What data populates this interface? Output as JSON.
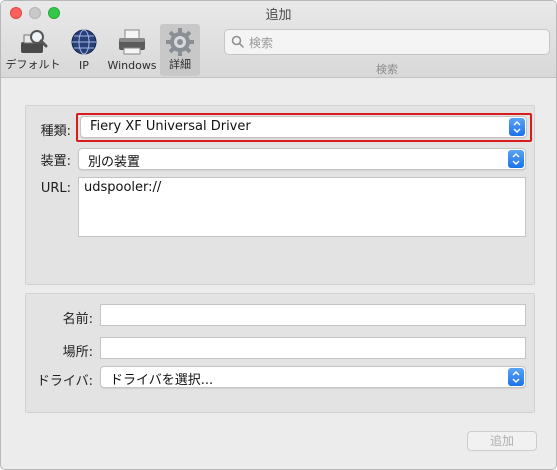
{
  "window": {
    "title": "追加"
  },
  "toolbar": {
    "items": [
      {
        "label": "デフォルト",
        "icon": "default-printers-icon"
      },
      {
        "label": "IP",
        "icon": "ip-globe-icon"
      },
      {
        "label": "Windows",
        "icon": "windows-printer-icon"
      },
      {
        "label": "詳細",
        "icon": "advanced-gear-icon",
        "selected": true
      }
    ],
    "search": {
      "placeholder": "検索",
      "caption": "検索"
    }
  },
  "form_top": {
    "type_label": "種類:",
    "type_value": "Fiery XF Universal Driver",
    "device_label": "装置:",
    "device_value": "別の装置",
    "url_label": "URL:",
    "url_value": "udspooler://"
  },
  "form_bottom": {
    "name_label": "名前:",
    "name_value": "",
    "location_label": "場所:",
    "location_value": "",
    "driver_label": "ドライバ:",
    "driver_value": "ドライバを選択..."
  },
  "footer": {
    "add_label": "追加",
    "add_enabled": false
  },
  "colors": {
    "accent": "#1a73e8",
    "focus_highlight": "#d81b1b"
  }
}
